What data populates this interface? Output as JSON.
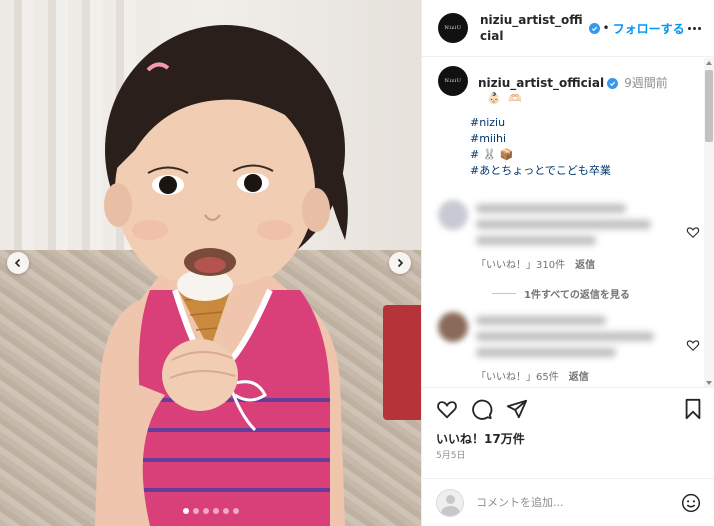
{
  "post": {
    "username": "niziu_artist_official",
    "avatar_text": "NiziU",
    "follow_label": "フォローする",
    "separator": "•",
    "more_icon": "more-horizontal-icon",
    "verified_icon": "verified-badge-icon"
  },
  "media": {
    "slide_count": 6,
    "active_slide": 0,
    "prev_icon": "chevron-left-icon",
    "next_icon": "chevron-right-icon"
  },
  "caption": {
    "username": "niziu_artist_official",
    "time": "9週間前",
    "emoji_line": "👶🏻 🫶🏻",
    "hashtags": [
      "#niziu",
      "#miihi",
      "# 🐰 📦",
      "#あとちょっとでこども卒業"
    ]
  },
  "comments": [
    {
      "likes": "「いいね！」310件",
      "reply_label": "返信",
      "view_replies": "1件すべての返信を見る"
    },
    {
      "likes": "「いいね！」65件",
      "reply_label": "返信"
    }
  ],
  "actions": {
    "like_icon": "heart-icon",
    "comment_icon": "comment-icon",
    "share_icon": "send-icon",
    "save_icon": "bookmark-icon"
  },
  "likes_text": "いいね！17万件",
  "date_text": "5月5日",
  "add_comment": {
    "placeholder": "コメントを追加...",
    "emoji_icon": "smile-icon"
  },
  "colors": {
    "link_blue": "#0095f6",
    "hashtag": "#00376b",
    "verified": "#3897f0"
  }
}
